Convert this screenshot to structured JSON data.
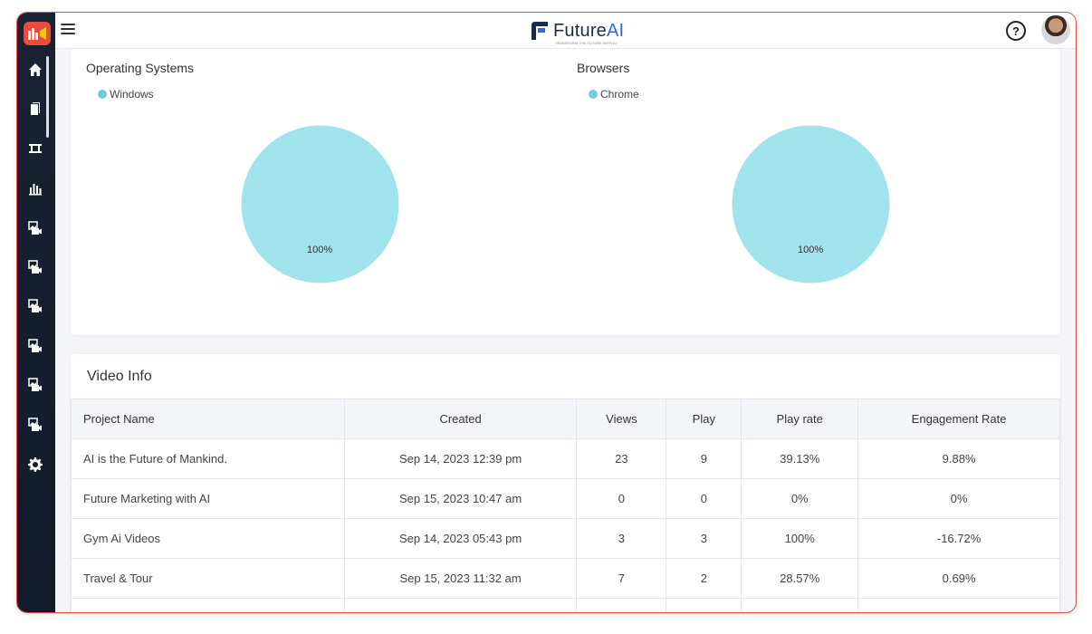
{
  "topbar": {
    "brand_name": "Future",
    "brand_ai": "AI",
    "brand_tagline": "TRANSFORM THE FUTURE WITH AI",
    "help_label": "?"
  },
  "sidebar": {
    "items": [
      {
        "icon": "home-icon"
      },
      {
        "icon": "document-icon"
      },
      {
        "icon": "video-strip-icon"
      },
      {
        "icon": "bar-chart-icon"
      },
      {
        "icon": "video-image-icon"
      },
      {
        "icon": "video-image-icon"
      },
      {
        "icon": "video-image-icon"
      },
      {
        "icon": "video-image-icon"
      },
      {
        "icon": "video-image-icon"
      },
      {
        "icon": "video-image-icon"
      },
      {
        "icon": "gear-icon"
      }
    ]
  },
  "charts": {
    "os": {
      "title": "Operating Systems",
      "legend": "Windows",
      "label": "100%"
    },
    "browsers": {
      "title": "Browsers",
      "legend": "Chrome",
      "label": "100%"
    }
  },
  "chart_data": [
    {
      "type": "pie",
      "title": "Operating Systems",
      "labels": [
        "Windows"
      ],
      "values": [
        100
      ],
      "colors": [
        "#a1e3ec"
      ],
      "legend": "top-left"
    },
    {
      "type": "pie",
      "title": "Browsers",
      "labels": [
        "Chrome"
      ],
      "values": [
        100
      ],
      "colors": [
        "#a1e3ec"
      ],
      "legend": "top-left"
    }
  ],
  "video_info": {
    "title": "Video Info",
    "columns": [
      "Project Name",
      "Created",
      "Views",
      "Play",
      "Play rate",
      "Engagement Rate"
    ],
    "rows": [
      [
        "AI is the Future of Mankind.",
        "Sep 14, 2023 12:39 pm",
        "23",
        "9",
        "39.13%",
        "9.88%"
      ],
      [
        "Future Marketing with AI",
        "Sep 15, 2023 10:47 am",
        "0",
        "0",
        "0%",
        "0%"
      ],
      [
        "Gym Ai Videos",
        "Sep 14, 2023 05:43 pm",
        "3",
        "3",
        "100%",
        "-16.72%"
      ],
      [
        "Travel & Tour",
        "Sep 15, 2023 11:32 am",
        "7",
        "2",
        "28.57%",
        "0.69%"
      ]
    ]
  },
  "colors": {
    "accent": "#e74c3c",
    "sidebar_bg": "#1a2233",
    "pie_fill": "#a1e3ec",
    "legend_dot": "#6fcbe0",
    "brand_blue": "#2a6bd6"
  }
}
